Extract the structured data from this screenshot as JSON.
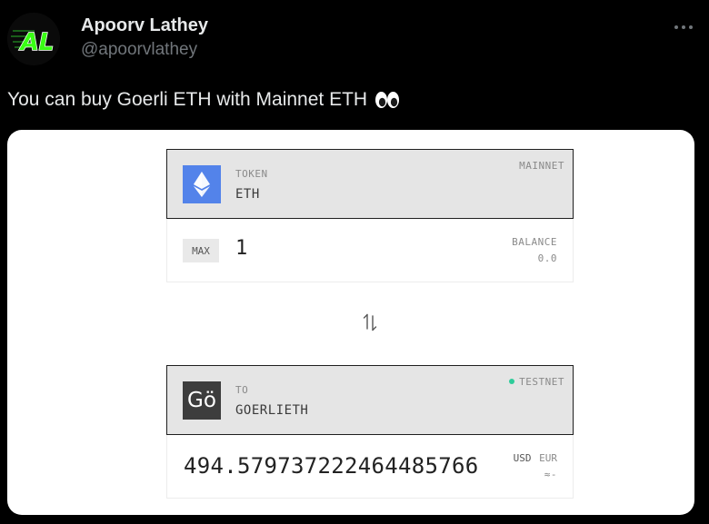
{
  "author": {
    "name": "Apoorv Lathey",
    "handle": "@apoorvlathey",
    "avatar_text": "AL"
  },
  "tweet": {
    "text": "You can buy Goerli ETH with Mainnet ETH",
    "emoji": "eyes-icon"
  },
  "card": {
    "from": {
      "network_label": "MAINNET",
      "token_label": "TOKEN",
      "token_name": "ETH",
      "max_label": "MAX",
      "amount": "1",
      "balance_label": "BALANCE",
      "balance_value": "0.0"
    },
    "swap_icon": "swap-arrows-icon",
    "to": {
      "network_label": "TESTNET",
      "network_dot_color": "#2ecc9a",
      "to_label": "TO",
      "token_name": "GOERLIETH",
      "logo_text": "Gö",
      "amount": "494.579737222464485766",
      "usd_label": "USD",
      "eur_label": "EUR",
      "fiat_value": "≈-"
    }
  },
  "colors": {
    "eth_logo_bg": "#5383ea",
    "goerli_logo_bg": "#3d3d3d",
    "panel_header_bg": "#e5e5e5",
    "avatar_accent": "#39ff14"
  }
}
